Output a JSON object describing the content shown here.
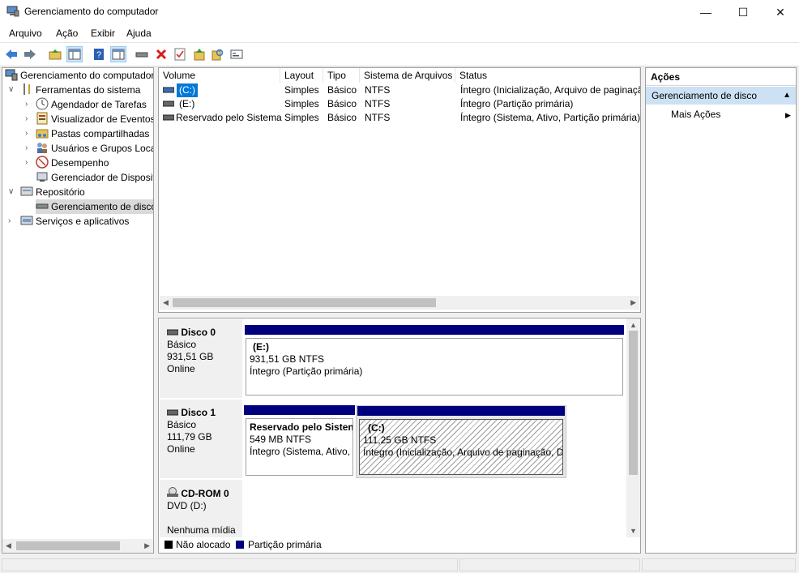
{
  "window": {
    "title": "Gerenciamento do computador",
    "minimize": "—",
    "maximize": "☐",
    "close": "✕"
  },
  "menu": [
    "Arquivo",
    "Ação",
    "Exibir",
    "Ajuda"
  ],
  "toolbar": [
    "back-icon",
    "forward-icon",
    "up-folder-icon",
    "show-hide-tree-icon",
    "help-icon",
    "properties-view-icon",
    "connect-drive-icon",
    "delete-icon",
    "check-icon",
    "import-icon",
    "search-icon",
    "settings-icon"
  ],
  "tree": {
    "root": "Gerenciamento do computador",
    "items": [
      {
        "label": "Ferramentas do sistema",
        "level": 1,
        "expander": "∨"
      },
      {
        "label": "Agendador de Tarefas",
        "level": 2,
        "expander": "›"
      },
      {
        "label": "Visualizador de Eventos",
        "level": 2,
        "expander": "›"
      },
      {
        "label": "Pastas compartilhadas",
        "level": 2,
        "expander": "›"
      },
      {
        "label": "Usuários e Grupos Loca",
        "level": 2,
        "expander": "›"
      },
      {
        "label": "Desempenho",
        "level": 2,
        "expander": "›"
      },
      {
        "label": "Gerenciador de Disposit",
        "level": 2,
        "expander": ""
      },
      {
        "label": "Repositório",
        "level": 1,
        "expander": "∨"
      },
      {
        "label": "Gerenciamento de disco",
        "level": 2,
        "expander": ""
      },
      {
        "label": "Serviços e aplicativos",
        "level": 1,
        "expander": "›"
      }
    ]
  },
  "volumes": {
    "columns": [
      "Volume",
      "Layout",
      "Tipo",
      "Sistema de Arquivos",
      "Status"
    ],
    "rows": [
      [
        "(C:)",
        "Simples",
        "Básico",
        "NTFS",
        "Íntegro (Inicialização, Arquivo de paginaçã"
      ],
      [
        "(E:)",
        "Simples",
        "Básico",
        "NTFS",
        "Íntegro (Partição primária)"
      ],
      [
        "Reservado pelo Sistema",
        "Simples",
        "Básico",
        "NTFS",
        "Íntegro (Sistema, Ativo, Partição primária)"
      ]
    ]
  },
  "disks": [
    {
      "name": "Disco 0",
      "type": "Básico",
      "size": "931,51 GB",
      "state": "Online",
      "partitions": [
        {
          "name": "(E:)",
          "size": "931,51 GB NTFS",
          "status": "Íntegro (Partição primária)"
        }
      ]
    },
    {
      "name": "Disco 1",
      "type": "Básico",
      "size": "111,79 GB",
      "state": "Online",
      "partitions": [
        {
          "name": "Reservado pelo Sisten",
          "size": "549 MB NTFS",
          "status": "Íntegro (Sistema, Ativo,"
        },
        {
          "name": "(C:)",
          "size": "111,25 GB NTFS",
          "status": "Íntegro (Inicialização, Arquivo de paginação, D"
        }
      ]
    },
    {
      "name": "CD-ROM 0",
      "type": "DVD (D:)",
      "state": "Nenhuma mídia"
    }
  ],
  "legend": [
    {
      "label": "Não alocado",
      "color": "#000000"
    },
    {
      "label": "Partição primária",
      "color": "#00007f"
    }
  ],
  "actions": {
    "header": "Ações",
    "section": "Gerenciamento de disco",
    "item": "Mais Ações"
  }
}
